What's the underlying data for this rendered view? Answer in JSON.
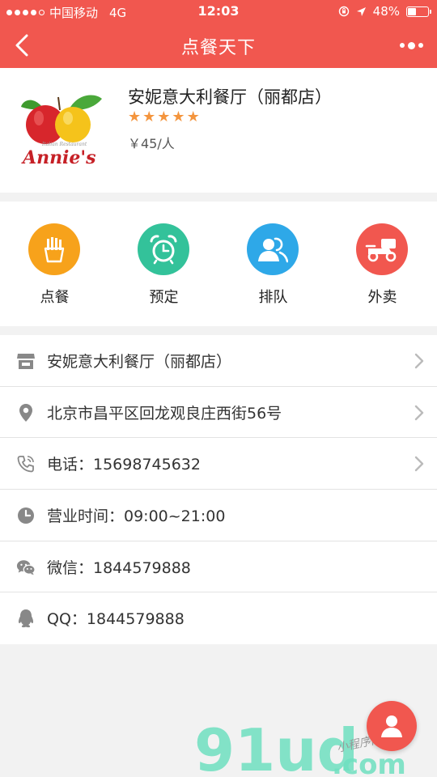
{
  "status_bar": {
    "carrier": "中国移动",
    "network": "4G",
    "time": "12:03",
    "battery": "48%",
    "battery_level": 0.48
  },
  "nav": {
    "title": "点餐天下"
  },
  "restaurant": {
    "name": "安妮意大利餐厅（丽都店）",
    "rating": 5,
    "price": "￥45/人",
    "logo_text": "Annie's"
  },
  "services": [
    {
      "label": "点餐",
      "icon": "fries-icon",
      "color": "#f7a21b"
    },
    {
      "label": "预定",
      "icon": "alarm-clock-icon",
      "color": "#33c29a"
    },
    {
      "label": "排队",
      "icon": "people-icon",
      "color": "#2ea8e8"
    },
    {
      "label": "外卖",
      "icon": "scooter-icon",
      "color": "#f1574f"
    }
  ],
  "info_rows": [
    {
      "text": "安妮意大利餐厅（丽都店）",
      "icon": "store-icon",
      "chevron": true
    },
    {
      "text": "北京市昌平区回龙观良庄西街56号",
      "icon": "location-pin-icon",
      "chevron": true
    },
    {
      "text": "电话：15698745632",
      "icon": "phone-icon",
      "chevron": true
    },
    {
      "text": "营业时间：09:00~21:00",
      "icon": "clock-icon",
      "chevron": false
    },
    {
      "text": "微信：1844579888",
      "icon": "wechat-icon",
      "chevron": false
    },
    {
      "text": "QQ：1844579888",
      "icon": "qq-icon",
      "chevron": false
    }
  ],
  "watermark": {
    "brand": "91ud",
    "domain": ".com",
    "tagline": "小程序商店"
  },
  "colors": {
    "primary": "#f1574f",
    "star": "#f4953e"
  }
}
